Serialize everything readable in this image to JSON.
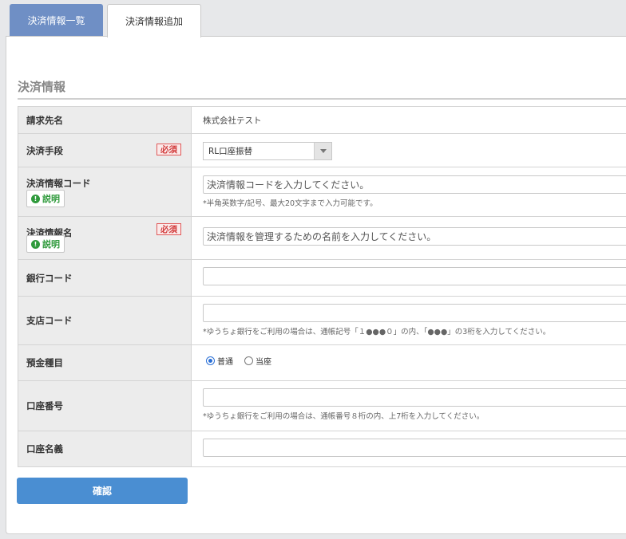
{
  "tabs": {
    "list_label": "決済情報一覧",
    "add_label": "決済情報追加"
  },
  "section": {
    "title": "決済情報"
  },
  "badges": {
    "required": "必須",
    "help": "説明"
  },
  "form": {
    "billing_name": {
      "label": "請求先名",
      "value": "株式会社テスト"
    },
    "payment_method": {
      "label": "決済手段",
      "value": "RL口座振替"
    },
    "payment_code": {
      "label": "決済情報コード",
      "placeholder": "決済情報コードを入力してください。",
      "note": "*半角英数字/記号、最大20文字まで入力可能です。"
    },
    "payment_name": {
      "label": "決済情報名",
      "placeholder": "決済情報を管理するための名前を入力してください。"
    },
    "bank_code": {
      "label": "銀行コード",
      "value": ""
    },
    "branch_code": {
      "label": "支店コード",
      "value": "",
      "note": "*ゆうちょ銀行をご利用の場合は、通帳記号「１●●●０」の内、「●●●」の3桁を入力してください。"
    },
    "account_type": {
      "label": "預金種目",
      "options": [
        "普通",
        "当座"
      ],
      "selected": "普通"
    },
    "account_number": {
      "label": "口座番号",
      "value": "",
      "note": "*ゆうちょ銀行をご利用の場合は、通帳番号８桁の内、上7桁を入力してください。"
    },
    "account_holder": {
      "label": "口座名義",
      "value": ""
    }
  },
  "submit": {
    "label": "確認"
  },
  "colors": {
    "accent": "#4a8ed2",
    "tab_active": "#6f8fc5",
    "required": "#d23c3c",
    "help": "#2f9a3c"
  }
}
